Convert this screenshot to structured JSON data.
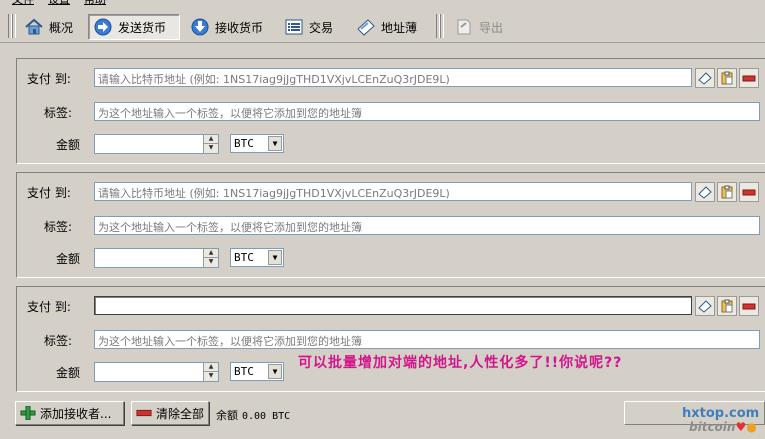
{
  "menu": {
    "items": [
      "文件",
      "设置",
      "帮助"
    ]
  },
  "toolbar": {
    "overview": "概况",
    "send": "发送货币",
    "receive": "接收货币",
    "transactions": "交易",
    "address_book": "地址薄",
    "export": "导出"
  },
  "recipients": [
    {
      "pay_to_label": "支付 到:",
      "pay_to_placeholder": "请输入比特币地址 (例如: 1NS17iag9jJgTHD1VXjvLCEnZuQ3rJDE9L)",
      "label_label": "标签:",
      "label_placeholder": "为这个地址输入一个标签，以便将它添加到您的地址簿",
      "amount_label": "金额",
      "amount_value": "",
      "unit": "BTC"
    },
    {
      "pay_to_label": "支付 到:",
      "pay_to_placeholder": "请输入比特币地址 (例如: 1NS17iag9jJgTHD1VXjvLCEnZuQ3rJDE9L)",
      "label_label": "标签:",
      "label_placeholder": "为这个地址输入一个标签，以便将它添加到您的地址簿",
      "amount_label": "金额",
      "amount_value": "",
      "unit": "BTC"
    },
    {
      "pay_to_label": "支付 到:",
      "pay_to_placeholder": "",
      "label_label": "标签:",
      "label_placeholder": "为这个地址输入一个标签，以便将它添加到您的地址簿",
      "amount_label": "金额",
      "amount_value": "",
      "unit": "BTC"
    }
  ],
  "annotation": "可以批量增加对端的地址,人性化多了!!你说呢??",
  "bottom": {
    "add_recipient": "添加接收者...",
    "clear_all": "清除全部",
    "balance_label": "余额",
    "balance_value": "0.00 BTC"
  },
  "watermark": {
    "line1": "hxtop.com",
    "line2": "bitcoin"
  },
  "colors": {
    "annotation": "#d4148c",
    "background": "#d4d0c8",
    "input_border": "#7f9db9"
  }
}
